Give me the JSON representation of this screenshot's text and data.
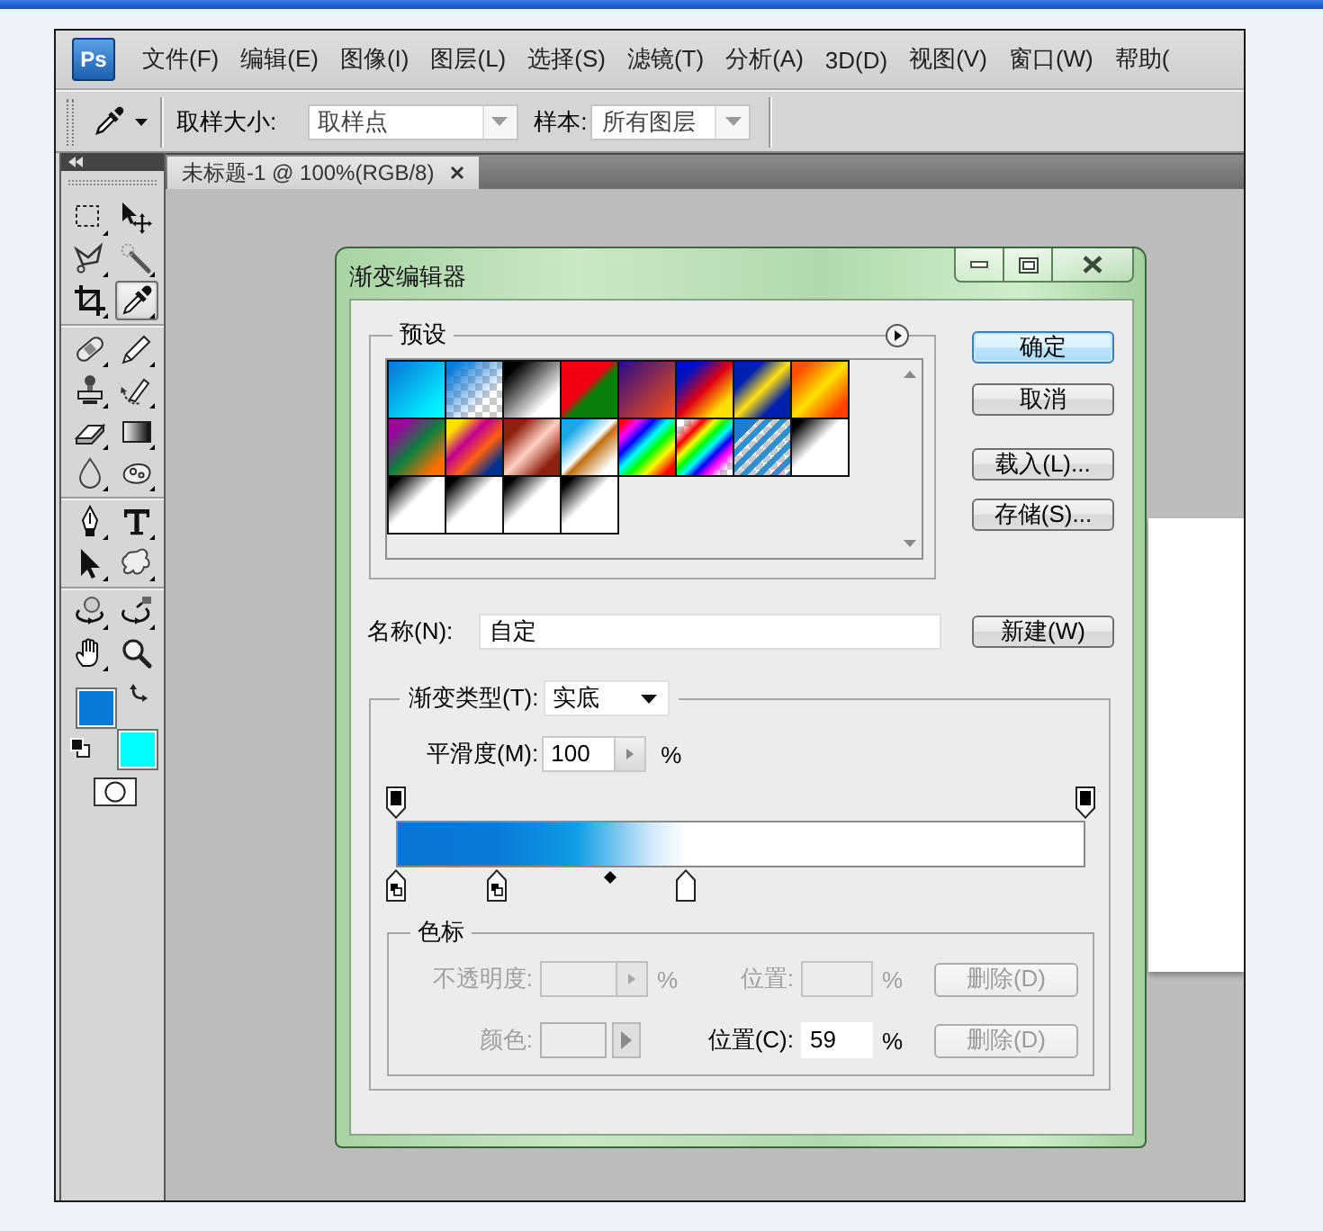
{
  "menu_bar": {
    "logo": "Ps",
    "items": [
      "文件(F)",
      "编辑(E)",
      "图像(I)",
      "图层(L)",
      "选择(S)",
      "滤镜(T)",
      "分析(A)",
      "3D(D)",
      "视图(V)",
      "窗口(W)",
      "帮助("
    ]
  },
  "options_bar": {
    "sample_size_label": "取样大小:",
    "sample_size": "取样点",
    "sample_label": "样本:",
    "sample": "所有图层"
  },
  "toolbox": {
    "groups": [
      {
        "tools": [
          {
            "kind": "marquee",
            "selected": false
          },
          {
            "kind": "move",
            "selected": false
          },
          {
            "kind": "lasso",
            "selected": false
          },
          {
            "kind": "wand",
            "selected": false
          },
          {
            "kind": "crop",
            "selected": false
          },
          {
            "kind": "eyedropper",
            "selected": true
          }
        ]
      },
      {
        "tools": [
          {
            "kind": "healing",
            "selected": false
          },
          {
            "kind": "brush",
            "selected": false
          },
          {
            "kind": "stamp",
            "selected": false
          },
          {
            "kind": "history",
            "selected": false
          },
          {
            "kind": "eraser",
            "selected": false
          },
          {
            "kind": "gradient",
            "selected": false
          },
          {
            "kind": "blur",
            "selected": false
          },
          {
            "kind": "toning",
            "selected": false
          }
        ]
      },
      {
        "tools": [
          {
            "kind": "pen",
            "selected": false
          },
          {
            "kind": "type",
            "selected": false
          },
          {
            "kind": "path",
            "selected": false
          },
          {
            "kind": "shape",
            "selected": false
          }
        ]
      },
      {
        "tools": [
          {
            "kind": "rotate3d",
            "selected": false
          },
          {
            "kind": "orbit3d",
            "selected": false
          },
          {
            "kind": "hand",
            "selected": false
          },
          {
            "kind": "zoom",
            "selected": false
          }
        ]
      }
    ],
    "colors": [
      {
        "kind": "foreground",
        "color": "#0a7ad8"
      },
      {
        "kind": "background",
        "color": "#00ffff"
      }
    ]
  },
  "document_tab": {
    "title": "未标题-1 @ 100%(RGB/8)"
  },
  "gradient_editor": {
    "title": "渐变编辑器",
    "presets": {
      "label": "预设",
      "items": [
        {
          "kind": "foreground-background",
          "selected": false
        },
        {
          "kind": "foreground-transparent",
          "selected": false
        },
        {
          "kind": "black-white",
          "selected": false
        },
        {
          "kind": "red-green",
          "selected": false
        },
        {
          "kind": "violet-orange",
          "selected": false
        },
        {
          "kind": "blue-red-yellow",
          "selected": false
        },
        {
          "kind": "blue-yellow-blue",
          "selected": false
        },
        {
          "kind": "orange-yellow-orange",
          "selected": false
        },
        {
          "kind": "violet-green-orange",
          "selected": false
        },
        {
          "kind": "yellow-violet-orange-blue",
          "selected": false
        },
        {
          "kind": "copper",
          "selected": false
        },
        {
          "kind": "chrome",
          "selected": false
        },
        {
          "kind": "spectrum",
          "selected": false
        },
        {
          "kind": "transparent-rainbow",
          "selected": false
        },
        {
          "kind": "transparent-stripes",
          "selected": false
        },
        {
          "kind": "black-corner",
          "selected": false
        },
        {
          "kind": "black-corner",
          "selected": false
        },
        {
          "kind": "black-corner",
          "selected": false
        },
        {
          "kind": "black-corner",
          "selected": false
        },
        {
          "kind": "black-corner",
          "selected": false
        }
      ]
    },
    "buttons": [
      {
        "label": "确定",
        "default": true
      },
      {
        "label": "取消",
        "default": false
      },
      {
        "label": "载入(L)...",
        "default": false
      },
      {
        "label": "存储(S)...",
        "default": false
      }
    ],
    "name": {
      "label": "名称(N):",
      "value": "自定"
    },
    "new_button": "新建(W)",
    "gradient_type": {
      "label": "渐变类型(T):",
      "value": "实底"
    },
    "smoothness": {
      "label": "平滑度(M):",
      "value": "100",
      "unit": "%"
    },
    "opacity_stops": [
      {
        "level": 0
      },
      {
        "level": 1
      }
    ],
    "color_stops": [
      {
        "kind": "foreground",
        "level": 0
      },
      {
        "kind": "foreground",
        "level": 0.145
      },
      {
        "kind": "plain",
        "level": 0.42
      }
    ],
    "midpoint": {
      "level": 0.31
    },
    "stops": {
      "label": "色标",
      "rows": [
        {
          "kind": "opacity",
          "label": "不透明度:",
          "unit": "%",
          "disabled": true,
          "location": {
            "label": "位置:",
            "unit": "%",
            "disabled": true
          },
          "delete_button": {
            "label": "删除(D)",
            "disabled": true
          }
        },
        {
          "kind": "color",
          "label": "颜色:",
          "disabled": true,
          "location": {
            "label": "位置(C):",
            "value": "59",
            "unit": "%",
            "disabled": false
          },
          "delete_button": {
            "label": "删除(D)",
            "disabled": true
          }
        }
      ]
    }
  }
}
